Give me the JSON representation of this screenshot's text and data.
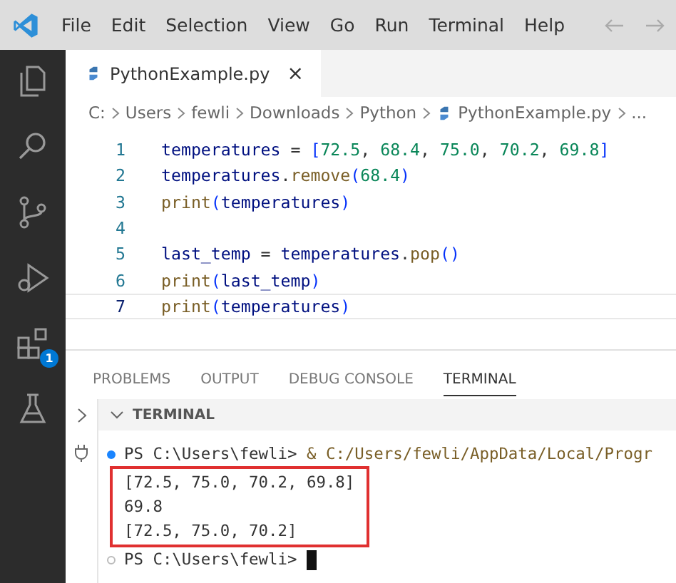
{
  "menu_bar": {
    "items": [
      "File",
      "Edit",
      "Selection",
      "View",
      "Go",
      "Run",
      "Terminal",
      "Help"
    ]
  },
  "activity_bar": {
    "extensions_badge": "1"
  },
  "editor_tabs": [
    {
      "label": "PythonExample.py",
      "selected": true,
      "close": "×"
    }
  ],
  "breadcrumb": [
    "C:",
    "Users",
    "fewli",
    "Downloads",
    "Python",
    "PythonExample.py",
    "..."
  ],
  "code": [
    {
      "number": "1",
      "current": false,
      "tokens": [
        {
          "kind": "var",
          "text": "temperatures"
        },
        {
          "kind": "plain",
          "text": " = "
        },
        {
          "kind": "bracket",
          "text": "["
        },
        {
          "kind": "num",
          "text": "72.5"
        },
        {
          "kind": "plain",
          "text": ", "
        },
        {
          "kind": "num",
          "text": "68.4"
        },
        {
          "kind": "plain",
          "text": ", "
        },
        {
          "kind": "num",
          "text": "75.0"
        },
        {
          "kind": "plain",
          "text": ", "
        },
        {
          "kind": "num",
          "text": "70.2"
        },
        {
          "kind": "plain",
          "text": ", "
        },
        {
          "kind": "num",
          "text": "69.8"
        },
        {
          "kind": "bracket",
          "text": "]"
        }
      ]
    },
    {
      "number": "2",
      "current": false,
      "tokens": [
        {
          "kind": "var",
          "text": "temperatures"
        },
        {
          "kind": "plain",
          "text": "."
        },
        {
          "kind": "func",
          "text": "remove"
        },
        {
          "kind": "bracket",
          "text": "("
        },
        {
          "kind": "num",
          "text": "68.4"
        },
        {
          "kind": "bracket",
          "text": ")"
        }
      ]
    },
    {
      "number": "3",
      "current": false,
      "tokens": [
        {
          "kind": "func",
          "text": "print"
        },
        {
          "kind": "bracket",
          "text": "("
        },
        {
          "kind": "var",
          "text": "temperatures"
        },
        {
          "kind": "bracket",
          "text": ")"
        }
      ]
    },
    {
      "number": "4",
      "current": false
    },
    {
      "number": "5",
      "current": false,
      "tokens": [
        {
          "kind": "var",
          "text": "last_temp"
        },
        {
          "kind": "plain",
          "text": " = "
        },
        {
          "kind": "var",
          "text": "temperatures"
        },
        {
          "kind": "plain",
          "text": "."
        },
        {
          "kind": "func",
          "text": "pop"
        },
        {
          "kind": "bracket",
          "text": "()"
        }
      ]
    },
    {
      "number": "6",
      "current": false,
      "tokens": [
        {
          "kind": "func",
          "text": "print"
        },
        {
          "kind": "bracket",
          "text": "("
        },
        {
          "kind": "var",
          "text": "last_temp"
        },
        {
          "kind": "bracket",
          "text": ")"
        }
      ]
    },
    {
      "number": "7",
      "current": true,
      "tokens": [
        {
          "kind": "func",
          "text": "print"
        },
        {
          "kind": "bracket",
          "text": "("
        },
        {
          "kind": "var",
          "text": "temperatures"
        },
        {
          "kind": "bracket",
          "text": ")"
        }
      ]
    }
  ],
  "panel_tabs": [
    {
      "label": "PROBLEMS",
      "selected": false
    },
    {
      "label": "OUTPUT",
      "selected": false
    },
    {
      "label": "DEBUG CONSOLE",
      "selected": false
    },
    {
      "label": "TERMINAL",
      "selected": true
    }
  ],
  "terminal": {
    "header": "TERMINAL",
    "expanded": true,
    "lines": [
      {
        "kind": "prompt",
        "succeeded": true,
        "prompt": "PS C:\\Users\\fewli> ",
        "command": "& C:/Users/fewli/AppData/Local/Progr",
        "cursor": false
      },
      {
        "kind": "output",
        "highlighted": true,
        "text": "[72.5, 75.0, 70.2, 69.8]"
      },
      {
        "kind": "output",
        "highlighted": true,
        "text": "69.8"
      },
      {
        "kind": "output",
        "highlighted": true,
        "text": "[72.5, 75.0, 70.2]"
      },
      {
        "kind": "prompt",
        "succeeded": false,
        "prompt": "PS C:\\Users\\fewli> ",
        "cursor": true
      }
    ]
  }
}
